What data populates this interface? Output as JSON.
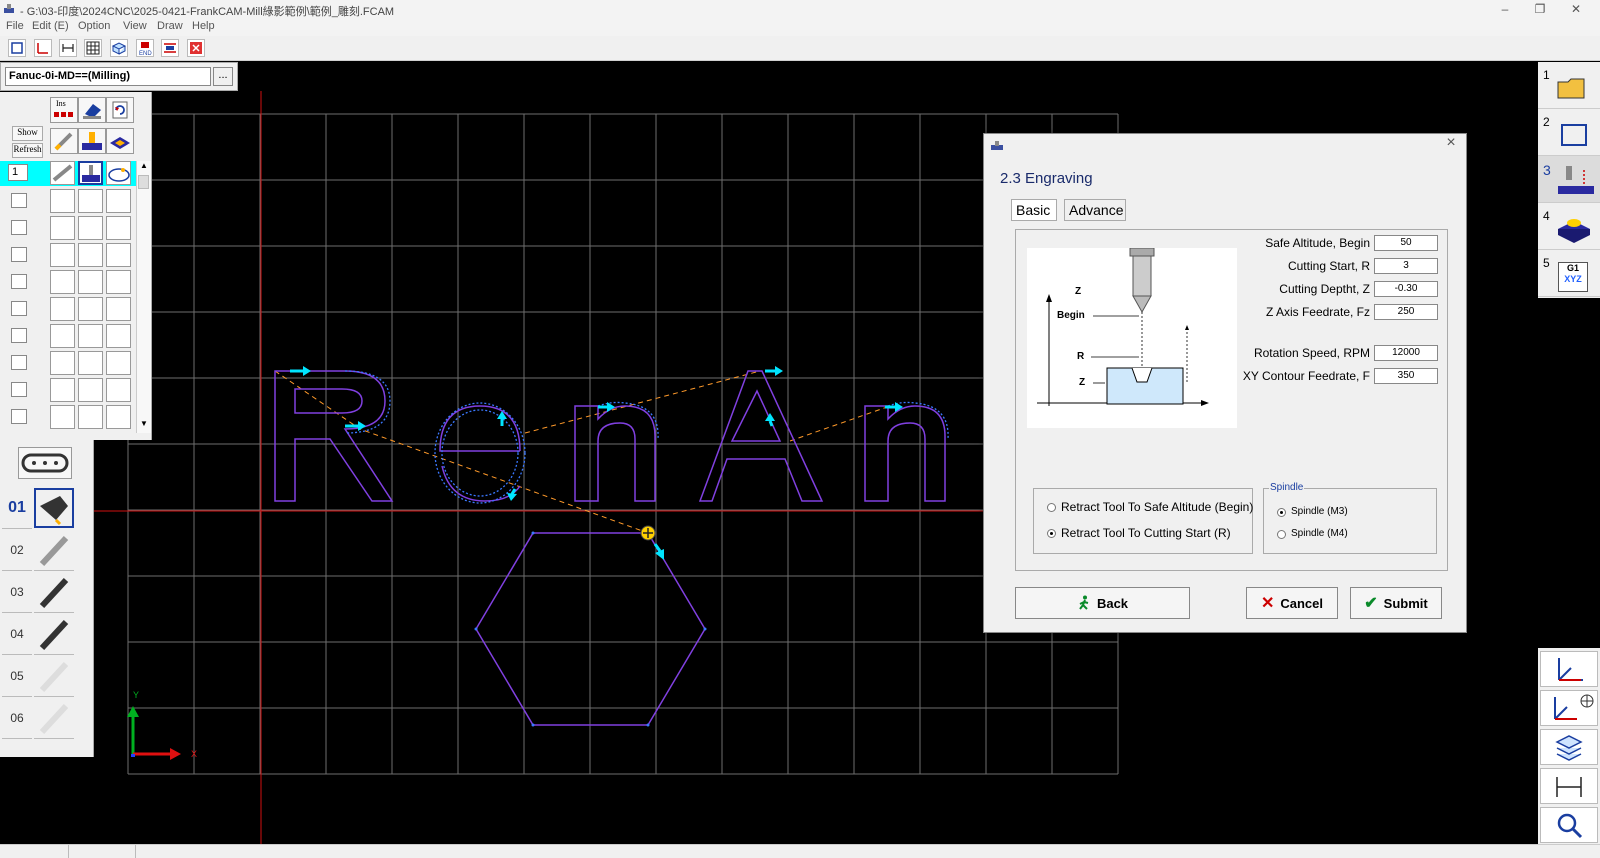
{
  "window": {
    "title": "- G:\\03-印度\\2024CNC\\2025-0421-FrankCAM-Mill綠影範例\\範例_雕刻.FCAM"
  },
  "menu": [
    "File",
    "Edit (E)",
    "Option",
    "View",
    "Draw",
    "Help"
  ],
  "controller": {
    "value": "Fanuc-0i-MD==(Milling)",
    "browse_label": "..."
  },
  "op_panel": {
    "ins_label": "Ins",
    "show_label": "Show",
    "refresh_label": "Refresh",
    "first_row_number": "1"
  },
  "tools": [
    "01",
    "02",
    "03",
    "04",
    "05",
    "06"
  ],
  "axes": {
    "y": "Y",
    "x": "X"
  },
  "steps": [
    "1",
    "2",
    "3",
    "4",
    "5"
  ],
  "step5_icon_text": {
    "top": "G1",
    "bottom": "XYZ"
  },
  "dialog": {
    "title": "2.3 Engraving",
    "tabs": [
      "Basic",
      "Advance"
    ],
    "diagram": {
      "z": "Z",
      "begin": "Begin",
      "r": "R",
      "z2": "Z"
    },
    "params": [
      {
        "label": "Safe Altitude, Begin",
        "value": "50"
      },
      {
        "label": "Cutting Start, R",
        "value": "3"
      },
      {
        "label": "Cutting Deptht, Z",
        "value": "-0.30"
      },
      {
        "label": "Z Axis Feedrate, Fz",
        "value": "250"
      },
      {
        "label": "Rotation Speed, RPM",
        "value": "12000"
      },
      {
        "label": "XY Contour Feedrate, F",
        "value": "350"
      }
    ],
    "retract": {
      "option1": "Retract Tool To Safe Altitude (Begin)",
      "option2": "Retract Tool To Cutting Start (R)"
    },
    "spindle": {
      "legend": "Spindle",
      "option1": "Spindle (M3)",
      "option2": "Spindle (M4)"
    },
    "buttons": {
      "back": "Back",
      "cancel": "Cancel",
      "submit": "Submit"
    },
    "close": "×"
  },
  "colors": {
    "canvas": "#000000",
    "grid": "#6e6e6e",
    "toolpath": "#8040e0",
    "node": "#3a78ff",
    "arrow": "#00e5ff",
    "rapid": "#ff9a2a",
    "origin_line": "#d01010",
    "highlight_row": "#00ffff",
    "title_blue": "#1a2b6b"
  }
}
